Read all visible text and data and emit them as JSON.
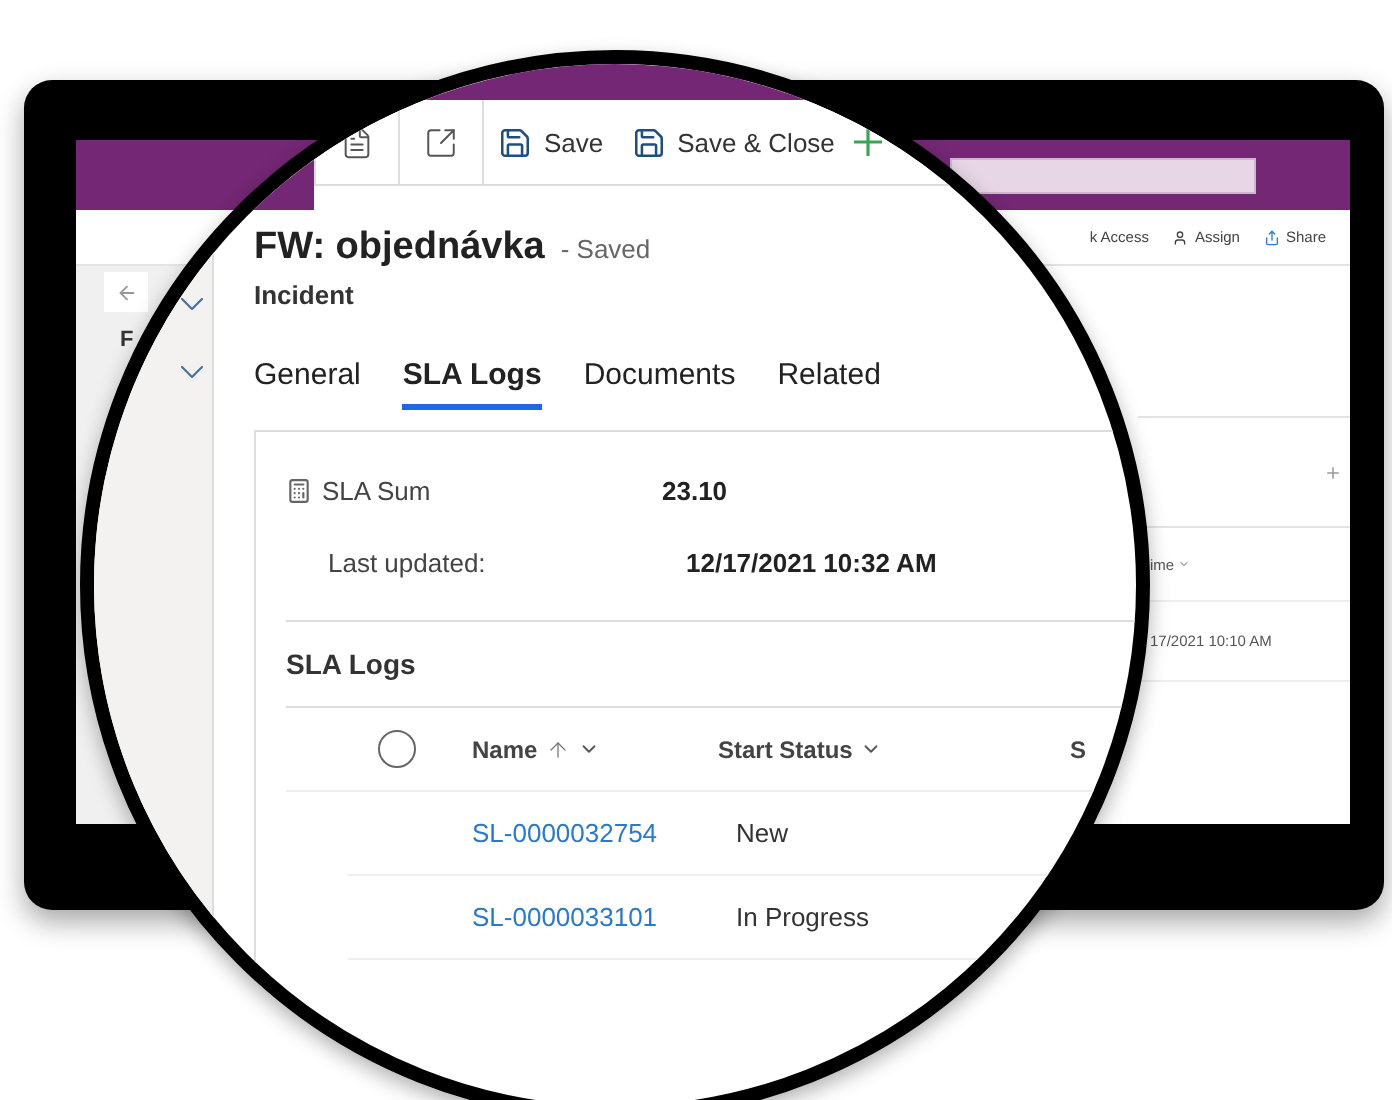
{
  "background_screen": {
    "nav": {
      "label": "F"
    },
    "commands": [
      {
        "kind": "text",
        "label": "k Access"
      },
      {
        "kind": "assign",
        "label": "Assign"
      },
      {
        "kind": "share",
        "label": "Share"
      }
    ],
    "grid": {
      "column_header": "ime",
      "cell": "17/2021 10:10 AM"
    }
  },
  "magnifier": {
    "command_bar": [
      {
        "kind": "form"
      },
      {
        "kind": "popout"
      },
      {
        "kind": "save",
        "label": "Save"
      },
      {
        "kind": "save-close",
        "label": "Save & Close"
      },
      {
        "kind": "new"
      }
    ],
    "record": {
      "title": "FW: objednávka",
      "status": "- Saved",
      "entity": "Incident"
    },
    "tabs": [
      {
        "label": "General",
        "selected": false
      },
      {
        "label": "SLA Logs",
        "selected": true
      },
      {
        "label": "Documents",
        "selected": false
      },
      {
        "label": "Related",
        "selected": false
      }
    ],
    "summary": [
      {
        "kind": "calc",
        "label": "SLA Sum",
        "value": "23.10"
      },
      {
        "kind": "plain",
        "label": "Last updated:",
        "value": "12/17/2021 10:32 AM"
      }
    ],
    "section": "SLA Logs",
    "grid": {
      "select_all": {
        "checked": false
      },
      "columns": [
        {
          "label": "Name",
          "sorted": true
        },
        {
          "label": "Start Status",
          "sorted": false
        },
        {
          "label": "S",
          "sorted": false
        }
      ],
      "rows": [
        {
          "name": "SL-0000032754",
          "start_status": "New"
        },
        {
          "name": "SL-0000033101",
          "start_status": "In Progress"
        }
      ]
    }
  }
}
